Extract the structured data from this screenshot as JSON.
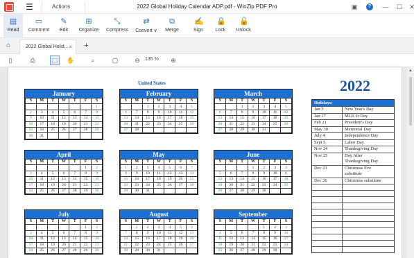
{
  "titlebar": {
    "actions": "Actions",
    "title": "2022 Global Holiday Calendar ADP.pdf - WinZip PDF Pro"
  },
  "ribbon": [
    {
      "label": "Read",
      "icon": "book-icon"
    },
    {
      "label": "Comment",
      "icon": "comment-icon"
    },
    {
      "label": "Edit",
      "icon": "edit-icon"
    },
    {
      "label": "Organize",
      "icon": "organize-icon"
    },
    {
      "label": "Compress",
      "icon": "compress-icon"
    },
    {
      "label": "Convert ∨",
      "icon": "convert-icon"
    },
    {
      "label": "Merge",
      "icon": "merge-icon"
    },
    {
      "label": "Sign",
      "icon": "sign-icon"
    },
    {
      "label": "Lock",
      "icon": "lock-icon"
    },
    {
      "label": "Unlock",
      "icon": "unlock-icon"
    }
  ],
  "tabs": {
    "doc": "2022 Global Holid...",
    "close": "×",
    "add": "+"
  },
  "toolbar": {
    "zoom": "135 %"
  },
  "document": {
    "country": "United States",
    "year": "2022",
    "day_headers": [
      "S",
      "M",
      "T",
      "W",
      "T",
      "F",
      "S"
    ],
    "months": [
      {
        "name": "January",
        "weeks": [
          [
            "",
            "",
            "",
            "",
            "",
            "",
            "1"
          ],
          [
            "2",
            "3",
            "4",
            "5",
            "6",
            "7",
            "8"
          ],
          [
            "9",
            "10",
            "11",
            "12",
            "13",
            "14",
            "15"
          ],
          [
            "16",
            "17",
            "18",
            "19",
            "20",
            "21",
            "22"
          ],
          [
            "23",
            "24",
            "25",
            "26",
            "27",
            "28",
            "29"
          ],
          [
            "30",
            "31",
            "",
            "",
            "",
            "",
            ""
          ]
        ]
      },
      {
        "name": "February",
        "weeks": [
          [
            "",
            "",
            "1",
            "2",
            "3",
            "4",
            "5"
          ],
          [
            "6",
            "7",
            "8",
            "9",
            "10",
            "11",
            "12"
          ],
          [
            "13",
            "14",
            "15",
            "16",
            "17",
            "18",
            "19"
          ],
          [
            "20",
            "21",
            "22",
            "23",
            "24",
            "25",
            "26"
          ],
          [
            "27",
            "28",
            "",
            "",
            "",
            "",
            ""
          ]
        ]
      },
      {
        "name": "March",
        "weeks": [
          [
            "",
            "",
            "1",
            "2",
            "3",
            "4",
            "5"
          ],
          [
            "6",
            "7",
            "8",
            "9",
            "10",
            "11",
            "12"
          ],
          [
            "13",
            "14",
            "15",
            "16",
            "17",
            "18",
            "19"
          ],
          [
            "20",
            "21",
            "22",
            "23",
            "24",
            "25",
            "26"
          ],
          [
            "27",
            "28",
            "29",
            "30",
            "31",
            "",
            ""
          ]
        ]
      },
      {
        "name": "April",
        "weeks": [
          [
            "",
            "",
            "",
            "",
            "",
            "1",
            "2"
          ],
          [
            "3",
            "4",
            "5",
            "6",
            "7",
            "8",
            "9"
          ],
          [
            "10",
            "11",
            "12",
            "13",
            "14",
            "15",
            "16"
          ],
          [
            "17",
            "18",
            "19",
            "20",
            "21",
            "22",
            "23"
          ],
          [
            "24",
            "25",
            "26",
            "27",
            "28",
            "29",
            "30"
          ]
        ]
      },
      {
        "name": "May",
        "weeks": [
          [
            "1",
            "2",
            "3",
            "4",
            "5",
            "6",
            "7"
          ],
          [
            "8",
            "9",
            "10",
            "11",
            "12",
            "13",
            "14"
          ],
          [
            "15",
            "16",
            "17",
            "18",
            "19",
            "20",
            "21"
          ],
          [
            "22",
            "23",
            "24",
            "25",
            "26",
            "27",
            "28"
          ],
          [
            "29",
            "30",
            "31",
            "",
            "",
            "",
            ""
          ]
        ]
      },
      {
        "name": "June",
        "weeks": [
          [
            "",
            "",
            "",
            "1",
            "2",
            "3",
            "4"
          ],
          [
            "5",
            "6",
            "7",
            "8",
            "9",
            "10",
            "11"
          ],
          [
            "12",
            "13",
            "14",
            "15",
            "16",
            "17",
            "18"
          ],
          [
            "19",
            "20",
            "21",
            "22",
            "23",
            "24",
            "25"
          ],
          [
            "26",
            "27",
            "28",
            "29",
            "30",
            "",
            ""
          ]
        ]
      },
      {
        "name": "July",
        "weeks": [
          [
            "",
            "",
            "",
            "",
            "",
            "1",
            "2"
          ],
          [
            "3",
            "4",
            "5",
            "6",
            "7",
            "8",
            "9"
          ],
          [
            "10",
            "11",
            "12",
            "13",
            "14",
            "15",
            "16"
          ],
          [
            "17",
            "18",
            "19",
            "20",
            "21",
            "22",
            "23"
          ],
          [
            "24",
            "25",
            "26",
            "27",
            "28",
            "29",
            "30"
          ]
        ]
      },
      {
        "name": "August",
        "weeks": [
          [
            "",
            "1",
            "2",
            "3",
            "4",
            "5",
            "6"
          ],
          [
            "7",
            "8",
            "9",
            "10",
            "11",
            "12",
            "13"
          ],
          [
            "14",
            "15",
            "16",
            "17",
            "18",
            "19",
            "20"
          ],
          [
            "21",
            "22",
            "23",
            "24",
            "25",
            "26",
            "27"
          ],
          [
            "28",
            "29",
            "30",
            "31",
            "",
            "",
            ""
          ]
        ]
      },
      {
        "name": "September",
        "weeks": [
          [
            "",
            "",
            "",
            "",
            "1",
            "2",
            "3"
          ],
          [
            "4",
            "5",
            "6",
            "7",
            "8",
            "9",
            "10"
          ],
          [
            "11",
            "12",
            "13",
            "14",
            "15",
            "16",
            "17"
          ],
          [
            "18",
            "19",
            "20",
            "21",
            "22",
            "23",
            "24"
          ],
          [
            "25",
            "26",
            "27",
            "28",
            "29",
            "30",
            ""
          ]
        ]
      }
    ],
    "holidays_title": "Holidays:",
    "holidays": [
      {
        "date": "Jan 3",
        "name": "New Year's Day"
      },
      {
        "date": "Jan 17",
        "name": "MLK Jr Day"
      },
      {
        "date": "Feb 21",
        "name": "President's Day"
      },
      {
        "date": "May 30",
        "name": "Memorial Day"
      },
      {
        "date": "July 4",
        "name": "Independence Day"
      },
      {
        "date": "Sept 5",
        "name": "Labor Day"
      },
      {
        "date": "Nov 24",
        "name": "Thanksgiving Day"
      },
      {
        "date": "Nov 25",
        "name": "Day After\nThanksgiving Day"
      },
      {
        "date": "Dec 23",
        "name": "Christmas Eve\nsubstitute"
      },
      {
        "date": "Dec 26",
        "name": "Christmas substitute"
      },
      {
        "date": "",
        "name": ""
      },
      {
        "date": "",
        "name": ""
      },
      {
        "date": "",
        "name": ""
      },
      {
        "date": "",
        "name": ""
      },
      {
        "date": "",
        "name": ""
      },
      {
        "date": "",
        "name": ""
      },
      {
        "date": "",
        "name": ""
      },
      {
        "date": "",
        "name": ""
      },
      {
        "date": "",
        "name": ""
      },
      {
        "date": "",
        "name": ""
      },
      {
        "date": "",
        "name": ""
      }
    ]
  }
}
